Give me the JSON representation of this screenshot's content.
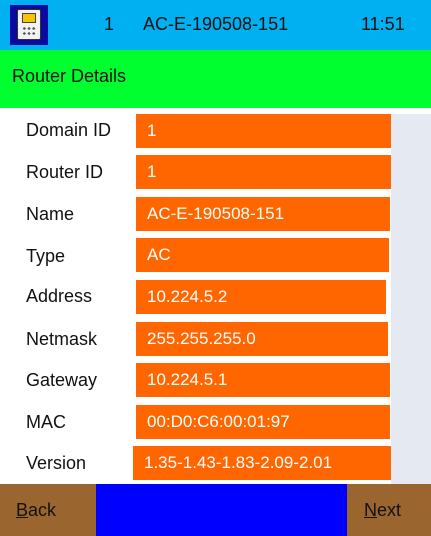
{
  "status_bar": {
    "icon": "handheld-device-icon",
    "number": "1",
    "hostname": "AC-E-190508-151",
    "time": "11:51"
  },
  "title": "Router Details",
  "fields": [
    {
      "label": "Domain ID",
      "value": "1"
    },
    {
      "label": "Router ID",
      "value": "1"
    },
    {
      "label": "Name",
      "value": "AC-E-190508-151"
    },
    {
      "label": "Type",
      "value": "AC"
    },
    {
      "label": "Address",
      "value": "10.224.5.2"
    },
    {
      "label": "Netmask",
      "value": "255.255.255.0"
    },
    {
      "label": "Gateway",
      "value": "10.224.5.1"
    },
    {
      "label": "MAC",
      "value": "00:D0:C6:00:01:97"
    },
    {
      "label": "Version",
      "value": "1.35-1.43-1.83-2.09-2.01"
    }
  ],
  "buttons": {
    "back": "Back",
    "next": "Next"
  },
  "colors": {
    "status_bar": "#00b0f0",
    "title_bar": "#00ff2e",
    "value_field": "#ff6600",
    "bottom_bar": "#0000ff",
    "button": "#9b6530",
    "side_panel": "#e5e9f1"
  }
}
